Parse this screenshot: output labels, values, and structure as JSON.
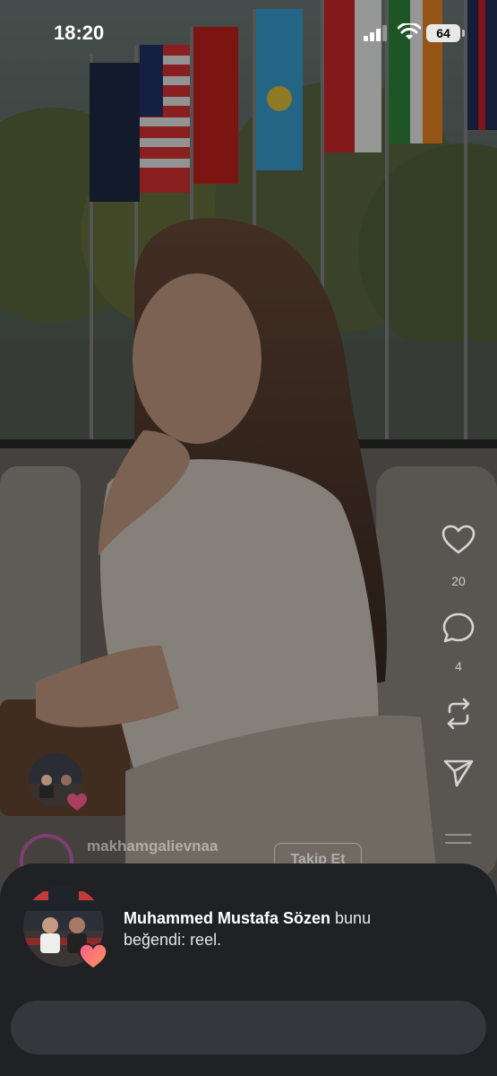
{
  "status_bar": {
    "time": "18:20",
    "battery": "64"
  },
  "reel": {
    "like_count": "20",
    "comment_count": "4",
    "author": "makhamgalievnaa",
    "follow_label": "Takip Et"
  },
  "notification": {
    "user": "Muhammed Mustafa Sözen",
    "action_line1": " bunu",
    "action_line2": "beğendi: reel."
  },
  "colors": {
    "sheet": "#1f2125",
    "input": "#35373c",
    "heart_gradient": [
      "#ff5a8a",
      "#ff9a5c"
    ]
  }
}
